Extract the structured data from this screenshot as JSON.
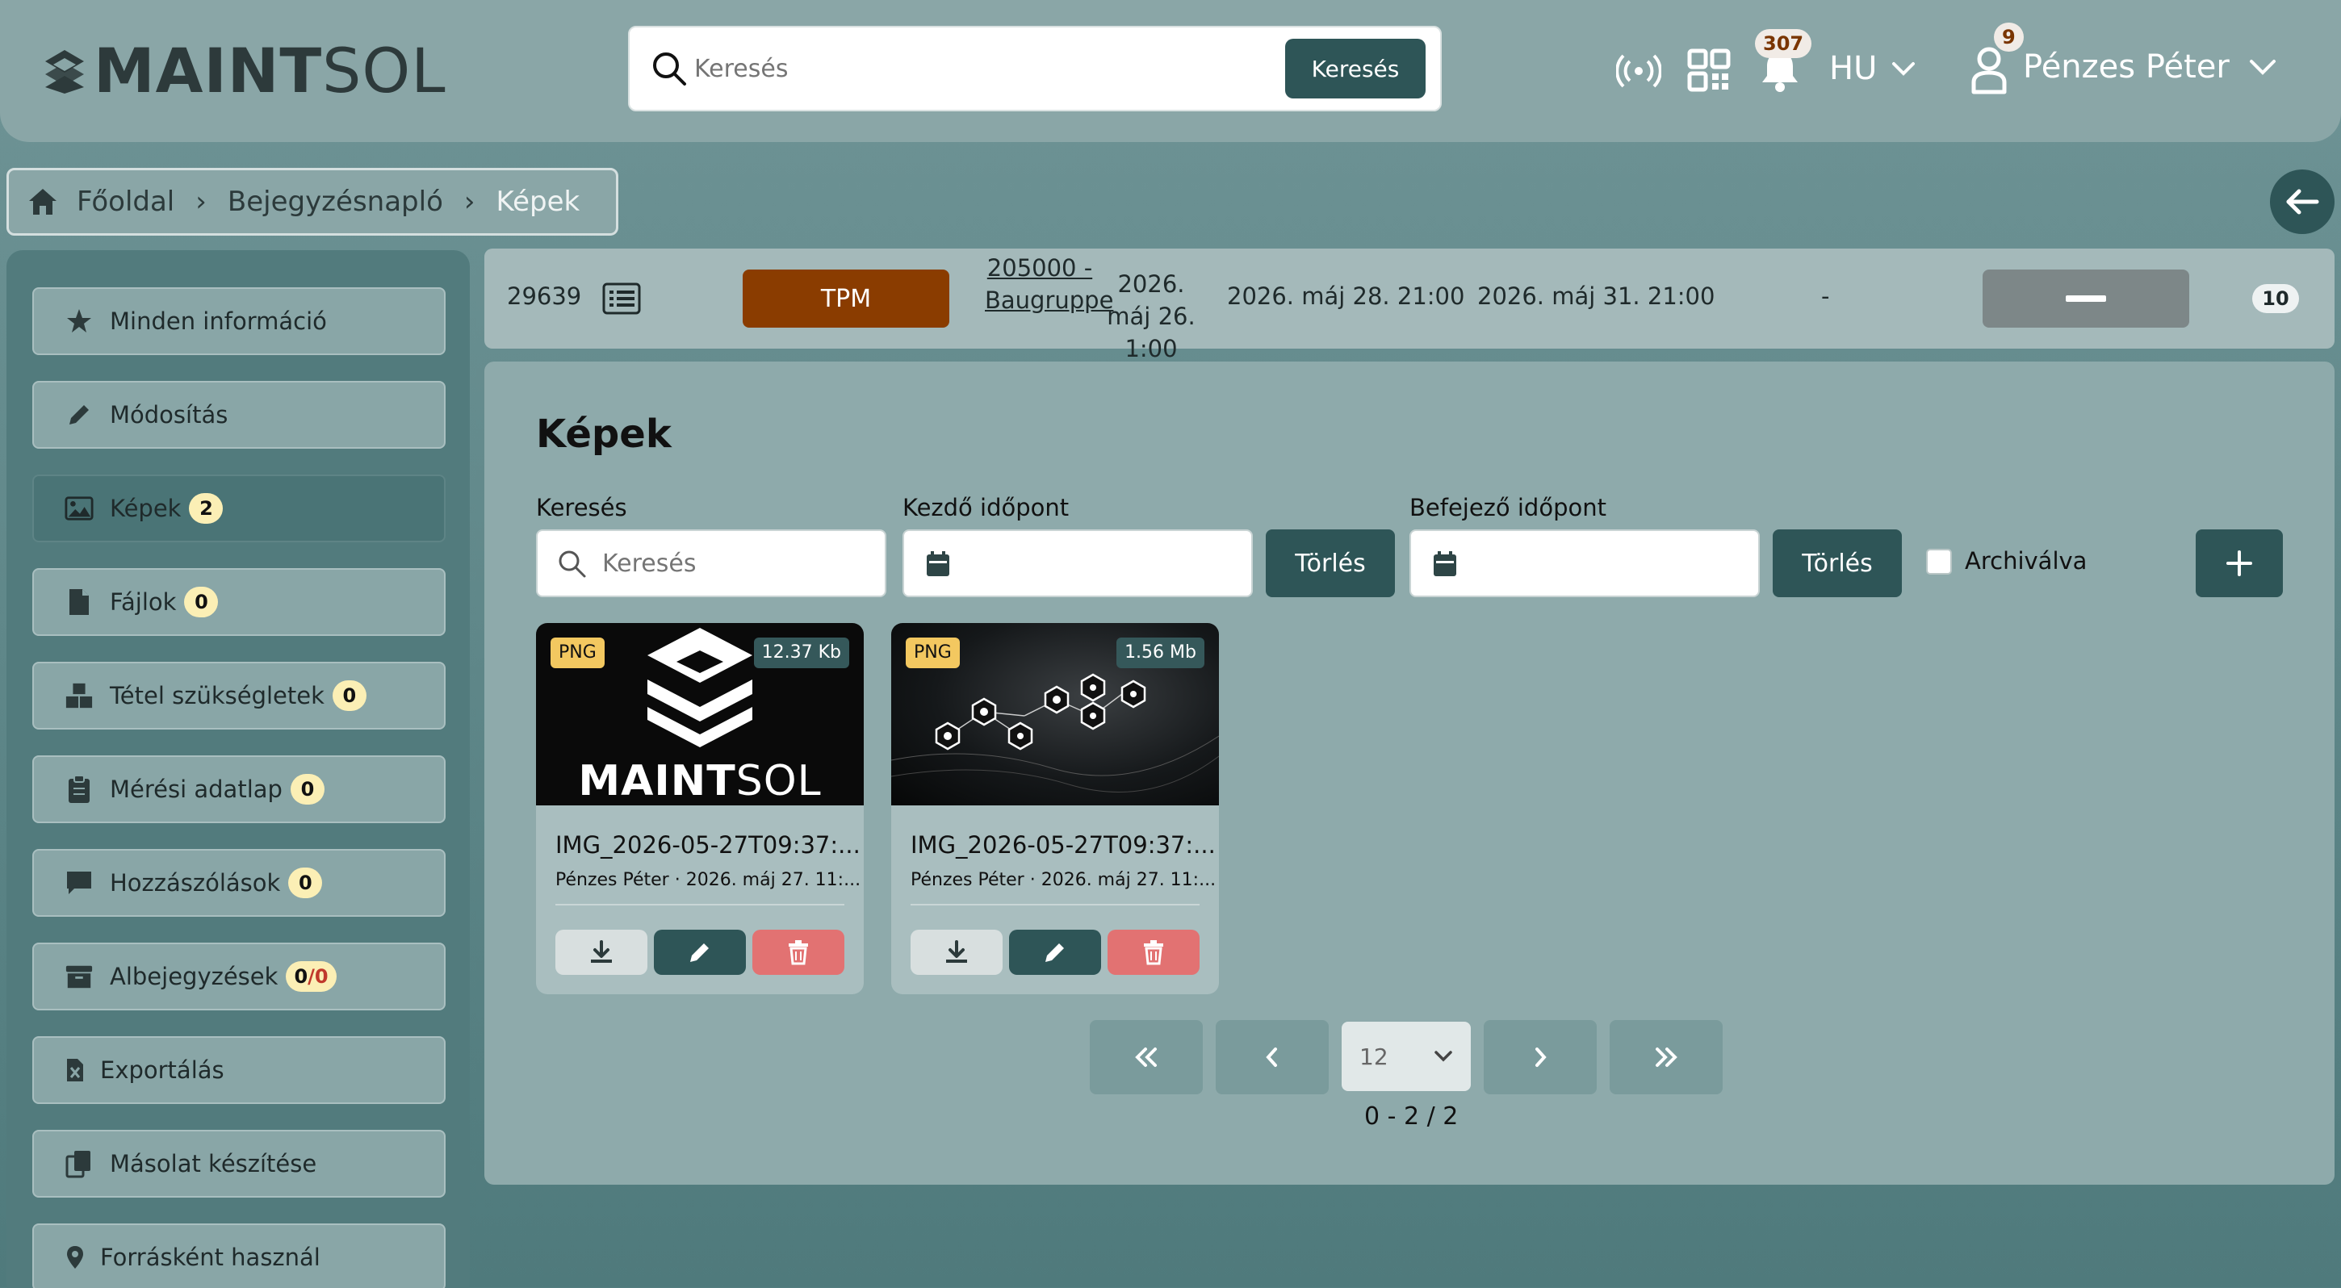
{
  "header": {
    "logo_bold": "MAINT",
    "logo_light": "SOL",
    "search_placeholder": "Keresés",
    "search_button": "Keresés",
    "notifications_count": "307",
    "language": "HU",
    "user_badge": "9",
    "user_name": "Pénzes Péter"
  },
  "breadcrumb": {
    "items": [
      "Főoldal",
      "Bejegyzésnapló",
      "Képek"
    ]
  },
  "sidebar": {
    "items": [
      {
        "label": "Minden információ",
        "icon": "star-icon"
      },
      {
        "label": "Módosítás",
        "icon": "pencil-icon"
      },
      {
        "label": "Képek",
        "icon": "image-icon",
        "count": "2"
      },
      {
        "label": "Fájlok",
        "icon": "file-icon",
        "count": "0"
      },
      {
        "label": "Tétel szükségletek",
        "icon": "boxes-icon",
        "count": "0"
      },
      {
        "label": "Mérési adatlap",
        "icon": "clipboard-icon",
        "count": "0"
      },
      {
        "label": "Hozzászólások",
        "icon": "comment-icon",
        "count": "0"
      },
      {
        "label": "Albejegyzések",
        "icon": "archive-icon",
        "count_a": "0",
        "count_b": "/0"
      },
      {
        "label": "Exportálás",
        "icon": "excel-icon"
      },
      {
        "label": "Másolat készítése",
        "icon": "copy-icon"
      },
      {
        "label": "Forrásként használ",
        "icon": "pin-icon"
      }
    ]
  },
  "entry": {
    "id": "29639",
    "type": "TPM",
    "project_link": "205000 - Baugruppe",
    "date_start": "2026. máj 26. 1:00",
    "date_2": "2026. máj 28. 21:00",
    "date_3": "2026. máj 31. 21:00",
    "dash": "-",
    "number": "10"
  },
  "main": {
    "title": "Képek",
    "search_label": "Keresés",
    "search_placeholder": "Keresés",
    "start_label": "Kezdő időpont",
    "end_label": "Befejező időpont",
    "clear_button": "Törlés",
    "archived_label": "Archiválva",
    "cards": [
      {
        "type": "PNG",
        "size": "12.37 Kb",
        "filename": "IMG_2026-05-27T09:37:...",
        "meta": "Pénzes Péter · 2026. máj 27. 11:...",
        "thumb_text_bold": "MAINT",
        "thumb_text_light": "SOL"
      },
      {
        "type": "PNG",
        "size": "1.56 Mb",
        "filename": "IMG_2026-05-27T09:37:...",
        "meta": "Pénzes Péter · 2026. máj 27. 11:..."
      }
    ],
    "pagination": {
      "page_size": "12",
      "info": "0 - 2 / 2"
    }
  },
  "colors": {
    "accent": "#2e5557",
    "tpm": "#8a3c00",
    "delete": "#e27272",
    "type_badge": "#f3c860",
    "count_badge": "#fbefb5"
  }
}
